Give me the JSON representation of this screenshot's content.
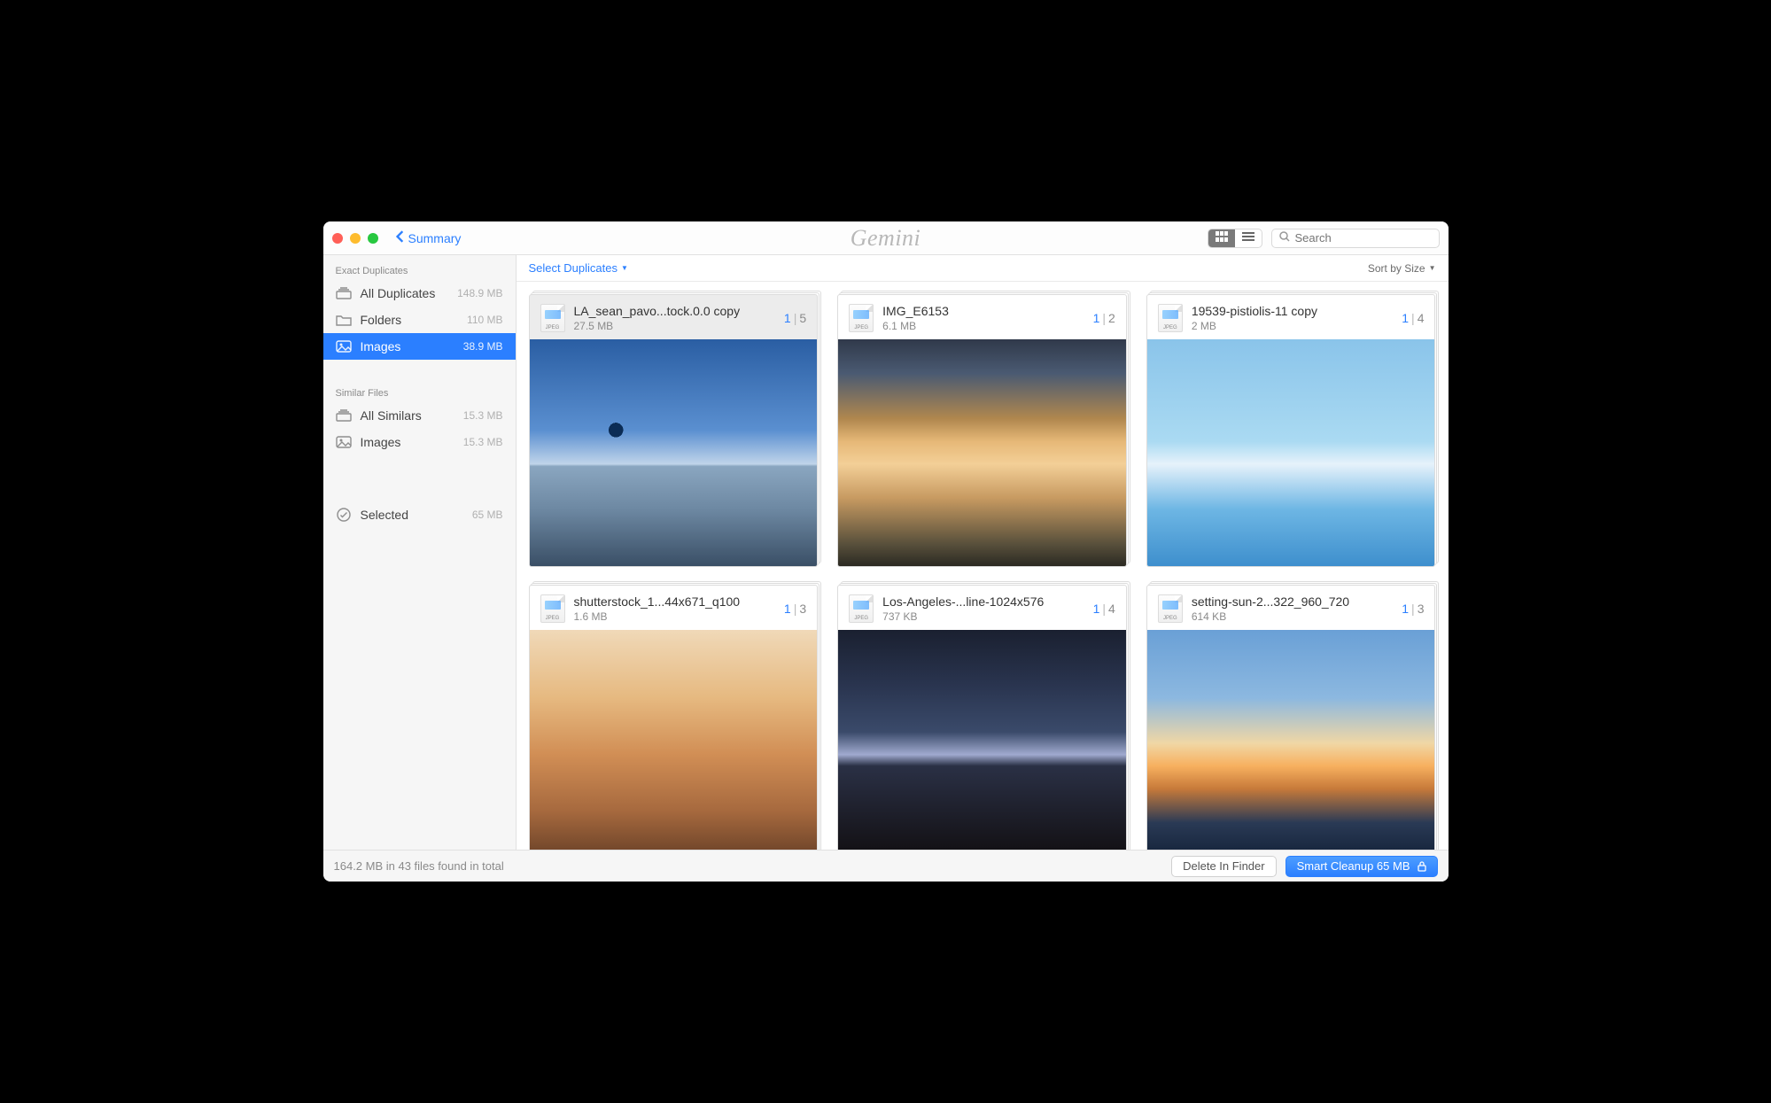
{
  "titlebar": {
    "back_label": "Summary",
    "app_name": "Gemini",
    "search_placeholder": "Search"
  },
  "sidebar": {
    "sections": [
      {
        "title": "Exact Duplicates",
        "items": [
          {
            "icon": "stack-icon",
            "label": "All Duplicates",
            "meta": "148.9 MB",
            "active": false
          },
          {
            "icon": "folder-icon",
            "label": "Folders",
            "meta": "110 MB",
            "active": false
          },
          {
            "icon": "image-icon",
            "label": "Images",
            "meta": "38.9 MB",
            "active": true
          }
        ]
      },
      {
        "title": "Similar Files",
        "items": [
          {
            "icon": "stack-icon",
            "label": "All Similars",
            "meta": "15.3 MB",
            "active": false
          },
          {
            "icon": "image-icon",
            "label": "Images",
            "meta": "15.3 MB",
            "active": false
          }
        ]
      }
    ],
    "selected": {
      "label": "Selected",
      "meta": "65 MB"
    }
  },
  "main_toolbar": {
    "select_label": "Select Duplicates",
    "sort_label": "Sort by Size"
  },
  "cards": [
    {
      "title": "LA_sean_pavo...tock.0.0 copy",
      "size": "27.5 MB",
      "selected": "1",
      "total": "5",
      "thumb": "t1",
      "is_selected": true
    },
    {
      "title": "IMG_E6153",
      "size": "6.1 MB",
      "selected": "1",
      "total": "2",
      "thumb": "t2",
      "is_selected": false
    },
    {
      "title": "19539-pistiolis-11 copy",
      "size": "2 MB",
      "selected": "1",
      "total": "4",
      "thumb": "t3",
      "is_selected": false
    },
    {
      "title": "shutterstock_1...44x671_q100",
      "size": "1.6 MB",
      "selected": "1",
      "total": "3",
      "thumb": "t4",
      "is_selected": false
    },
    {
      "title": "Los-Angeles-...line-1024x576",
      "size": "737 KB",
      "selected": "1",
      "total": "4",
      "thumb": "t5",
      "is_selected": false
    },
    {
      "title": "setting-sun-2...322_960_720",
      "size": "614 KB",
      "selected": "1",
      "total": "3",
      "thumb": "t6",
      "is_selected": false
    }
  ],
  "footer": {
    "status": "164.2 MB in 43 files found in total",
    "delete_label": "Delete In Finder",
    "cleanup_label": "Smart Cleanup 65 MB"
  },
  "filetype_label": "JPEG"
}
